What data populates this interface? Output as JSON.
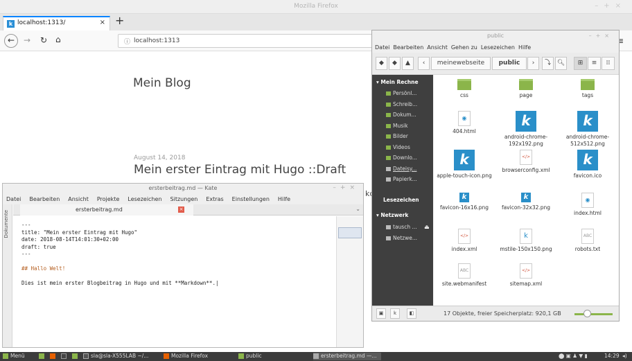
{
  "firefox": {
    "window_title": "Mozilla Firefox",
    "tab_label": "localhost:1313/",
    "tab_close": "×",
    "new_tab": "+",
    "url": "localhost:1313",
    "menu_icon": "≡",
    "page": {
      "blog_title": "Mein Blog",
      "post_date": "August 14, 2018",
      "post_title": "Mein erster Eintrag mit Hugo ::Draft",
      "overflow_text": "kd"
    }
  },
  "kate": {
    "window_title": "ersterbeitrag.md — Kate",
    "menu": [
      "Datei",
      "Bearbeiten",
      "Ansicht",
      "Projekte",
      "Lesezeichen",
      "Sitzungen",
      "Extras",
      "Einstellungen",
      "Hilfe"
    ],
    "sidebar_label": "Dokumente",
    "tab_label": "ersterbeitrag.md",
    "tab_close": "×",
    "lines": [
      "---",
      "title: \"Mein erster Eintrag mit Hugo\"",
      "date: 2018-08-14T14:01:30+02:00",
      "draft: true",
      "---",
      "",
      "## Hallo Welt!",
      "",
      "Dies ist mein erster Blogbeitrag in Hugo und mit **Markdown**.|"
    ]
  },
  "nemo": {
    "window_title": "public",
    "menu": [
      "Datei",
      "Bearbeiten",
      "Ansicht",
      "Gehen zu",
      "Lesezeichen",
      "Hilfe"
    ],
    "path": [
      "meinewebseite",
      "public"
    ],
    "sidebar": {
      "computer_header": "Mein Rechne",
      "computer_items": [
        "Persönl...",
        "Schreib...",
        "Dokum...",
        "Musik",
        "Bilder",
        "Videos",
        "Downlo...",
        "Dateisy...",
        "Papierk..."
      ],
      "bookmarks_header": "Lesezeichen",
      "network_header": "Netzwerk",
      "network_items": [
        "tausch ...",
        "Netzwe..."
      ]
    },
    "files": [
      {
        "name": "css",
        "kind": "folder"
      },
      {
        "name": "page",
        "kind": "folder"
      },
      {
        "name": "tags",
        "kind": "folder"
      },
      {
        "name": "404.html",
        "kind": "html"
      },
      {
        "name": "android-chrome-192x192.png",
        "kind": "k"
      },
      {
        "name": "android-chrome-512x512.png",
        "kind": "k"
      },
      {
        "name": "apple-touch-icon.png",
        "kind": "k"
      },
      {
        "name": "browserconfig.xml",
        "kind": "xml"
      },
      {
        "name": "favicon.ico",
        "kind": "k"
      },
      {
        "name": "favicon-16x16.png",
        "kind": "ksmall"
      },
      {
        "name": "favicon-32x32.png",
        "kind": "ksmall"
      },
      {
        "name": "index.html",
        "kind": "html"
      },
      {
        "name": "index.xml",
        "kind": "xml"
      },
      {
        "name": "mstile-150x150.png",
        "kind": "kdoc"
      },
      {
        "name": "robots.txt",
        "kind": "txt"
      },
      {
        "name": "site.webmanifest",
        "kind": "txt"
      },
      {
        "name": "sitemap.xml",
        "kind": "xml"
      }
    ],
    "status": "17 Objekte, freier Speicherplatz: 920,1 GB"
  },
  "taskbar": {
    "menu": "Menü",
    "items": [
      "sla@sla-X555LAB ~/...",
      "Mozilla Firefox",
      "public",
      "ersterbeitrag.md —..."
    ],
    "clock": "14:29"
  },
  "colors": {
    "accent_green": "#8bb54a",
    "hugo_blue": "#2a8fc9",
    "firefox_blue": "#0a84ff"
  }
}
